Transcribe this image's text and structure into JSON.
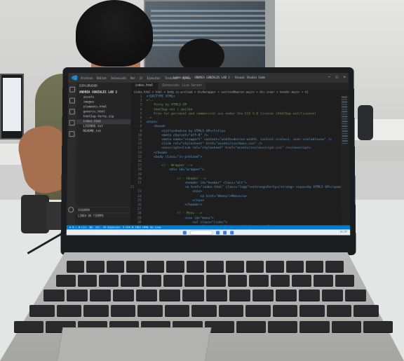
{
  "vscode": {
    "window_title": "index.html - ANDREA GONZALES LAB 2 - Visual Studio Code",
    "menu": [
      "Archivo",
      "Editar",
      "Selección",
      "Ver",
      "Ir",
      "Ejecutar",
      "Terminal",
      "Ayuda"
    ],
    "explorer": {
      "header": "EXPLORADOR",
      "project": "ANDREA GONZALES LAB 2",
      "files": [
        "assets",
        "images",
        "elements.html",
        "generic.html",
        "html5up-forty.zip",
        "index.html",
        "LICENSE.txt",
        "README.txt"
      ],
      "selected_index": 5,
      "bottom_sections": [
        "ESQUEMA",
        "LÍNEA DE TIEMPO"
      ]
    },
    "tabs": [
      "index.html",
      "Extensión: Live Server"
    ],
    "breadcrumb": "index.html > html > body.is-preload > div#wrapper > section#banner.major > div.inner > header.major > h1",
    "code_lines": [
      {
        "n": "1",
        "t": "<!DOCTYPE HTML>"
      },
      {
        "n": "2",
        "t": "<!--"
      },
      {
        "n": "3",
        "t": "    Forty by HTML5 UP"
      },
      {
        "n": "4",
        "t": "    html5up.net | @ajlkn"
      },
      {
        "n": "5",
        "t": "    Free for personal and commercial use under the CCA 3.0 license (html5up.net/license)"
      },
      {
        "n": "6",
        "t": "-->"
      },
      {
        "n": "7",
        "t": "<html>"
      },
      {
        "n": "8",
        "t": "    <head>"
      },
      {
        "n": "9",
        "t": "        <title>Andrea by HTML5 UP</title>"
      },
      {
        "n": "10",
        "t": "        <meta charset=\"utf-8\" />"
      },
      {
        "n": "11",
        "t": "        <meta name=\"viewport\" content=\"width=device-width, initial-scale=1, user-scalable=no\" />"
      },
      {
        "n": "12",
        "t": "        <link rel=\"stylesheet\" href=\"assets/css/main.css\" />"
      },
      {
        "n": "13",
        "t": "        <noscript><link rel=\"stylesheet\" href=\"assets/css/noscript.css\" /></noscript>"
      },
      {
        "n": "14",
        "t": "    </head>"
      },
      {
        "n": "15",
        "t": "    <body class=\"is-preload\">"
      },
      {
        "n": "16",
        "t": ""
      },
      {
        "n": "17",
        "t": "        <!-- Wrapper -->"
      },
      {
        "n": "18",
        "t": "            <div id=\"wrapper\">"
      },
      {
        "n": "19",
        "t": ""
      },
      {
        "n": "20",
        "t": "                <!-- Header -->"
      },
      {
        "n": "21",
        "t": "                    <header id=\"header\" class=\"alt\">"
      },
      {
        "n": "22",
        "t": "                        <a href=\"index.html\" class=\"logo\"><strong>Forty</strong> <span>by HTML5 UP</span></a>"
      },
      {
        "n": "23",
        "t": "                        <nav>"
      },
      {
        "n": "24",
        "t": "                            <a href=\"#menu\">Menu</a>"
      },
      {
        "n": "25",
        "t": "                        </nav>"
      },
      {
        "n": "26",
        "t": "                    </header>"
      },
      {
        "n": "27",
        "t": ""
      },
      {
        "n": "28",
        "t": "                <!-- Menu -->"
      },
      {
        "n": "29",
        "t": "                    <nav id=\"menu\">"
      },
      {
        "n": "30",
        "t": "                        <ul class=\"links\">"
      },
      {
        "n": "31",
        "t": "                            <li><a href=\"index.html\">Home</a></li>"
      },
      {
        "n": "32",
        "t": "                            <li><a href=\"landing.html\">Landing</a></li>"
      }
    ],
    "statusbar": "⊗ 0 ⚠ 0    Lín. 38, col. 34   Espacios: 4   UTF-8   CRLF   HTML   Go Live",
    "taskbar_time": "11:57"
  },
  "colors": {
    "editor_bg": "#1e1e1e",
    "statusbar": "#007acc",
    "keycap": "#2a2a2c"
  }
}
